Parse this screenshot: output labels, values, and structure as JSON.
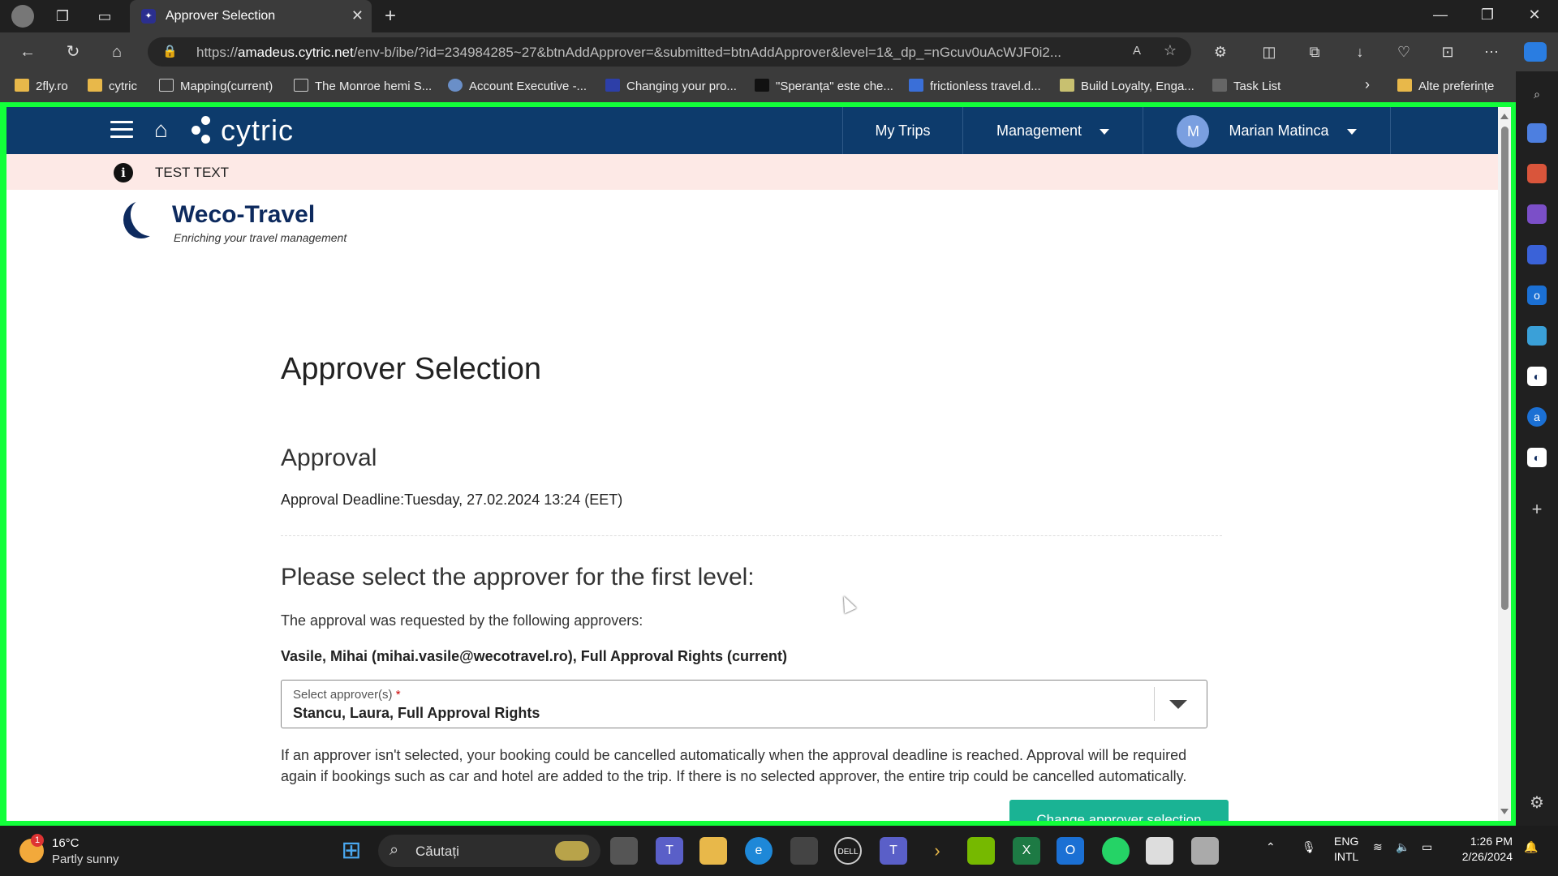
{
  "browser": {
    "tab_title": "Approver Selection",
    "url_host": "amadeus.cytric.net",
    "url_prefix": "https://",
    "url_rest": "/env-b/ibe/?id=234984285~27&btnAddApprover=&submitted=btnAddApprover&level=1&_dp_=nGcuv0uAcWJF0i2...",
    "bookmarks": [
      "2fly.ro",
      "cytric",
      "Mapping(current)",
      "The Monroe hemi S...",
      "Account Executive -...",
      "Changing your pro...",
      "\"Speranța\" este che...",
      "frictionless travel.d...",
      "Build Loyalty, Enga...",
      "Task List"
    ],
    "other_favorites": "Alte preferințe"
  },
  "app": {
    "logo": "cytric",
    "nav_my_trips": "My Trips",
    "nav_management": "Management",
    "user_initial": "M",
    "user_name": "Marian Matinca"
  },
  "banner": {
    "text": "TEST TEXT"
  },
  "brand": {
    "name": "Weco-Travel",
    "tagline": "Enriching your travel management"
  },
  "main": {
    "title": "Approver Selection",
    "section": "Approval",
    "deadline": "Approval Deadline:Tuesday, 27.02.2024 13:24 (EET)",
    "level_heading": "Please select the approver for the first level:",
    "requested_by": "The approval was requested by the following approvers:",
    "current_approver": "Vasile, Mihai (mihai.vasile@wecotravel.ro), Full Approval Rights (current)",
    "select_label": "Select approver(s)",
    "select_required": "*",
    "select_value": "Stancu, Laura, Full Approval Rights",
    "note": "If an approver isn't selected, your booking could be cancelled automatically when the approval deadline is reached. Approval will be required again if bookings such as car and hotel are added to the trip. If there is no selected approver, the entire trip could be cancelled automatically.",
    "cta": "Change approver selection"
  },
  "taskbar": {
    "temp": "16°C",
    "weather": "Partly sunny",
    "weather_badge": "1",
    "search": "Căutați",
    "lang1": "ENG",
    "lang2": "INTL",
    "time": "1:26 PM",
    "date": "2/26/2024"
  }
}
